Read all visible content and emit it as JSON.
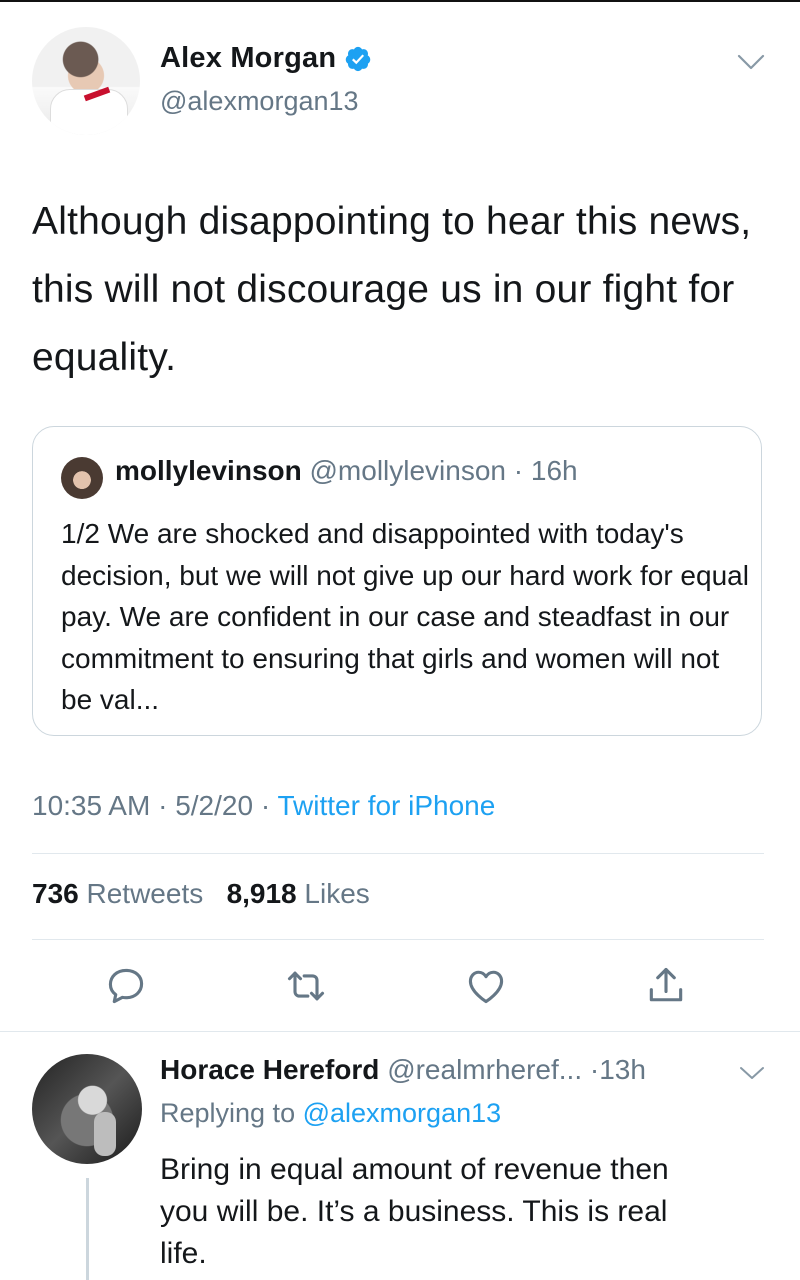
{
  "tweet": {
    "author_name": "Alex Morgan",
    "author_handle": "@alexmorgan13",
    "text": "Although disappointing to hear this news, this will not discourage us in our fight for equality.",
    "time": "10:35 AM",
    "date": "5/2/20",
    "separator": "·",
    "source": "Twitter for iPhone",
    "retweets_count": "736",
    "retweets_label": "Retweets",
    "likes_count": "8,918",
    "likes_label": "Likes"
  },
  "quote": {
    "author_name": "mollylevinson",
    "author_handle": "@mollylevinson",
    "age": "16h",
    "text": "1/2 We are shocked and disappointed with today's decision, but we will not give up our hard work for equal pay. We are confident in our case and steadfast in our commitment to ensuring that girls and women will not be val..."
  },
  "reply": {
    "author_name": "Horace Hereford",
    "author_handle": "@realmrheref...",
    "age": "13h",
    "replying_label": "Replying to",
    "replying_to": "@alexmorgan13",
    "text_line1": "Bring in equal amount of revenue then",
    "text_line2": "you will be. It’s a business. This is real",
    "text_line3": "life."
  },
  "icons": {
    "verified": "verified-badge-icon",
    "menu": "chevron-down-icon",
    "reply": "reply-bubble-icon",
    "retweet": "retweet-icon",
    "like": "heart-icon",
    "share": "share-icon"
  },
  "colors": {
    "accent": "#1da1f2",
    "secondary_text": "#657786",
    "divider": "#e1e8ed"
  }
}
